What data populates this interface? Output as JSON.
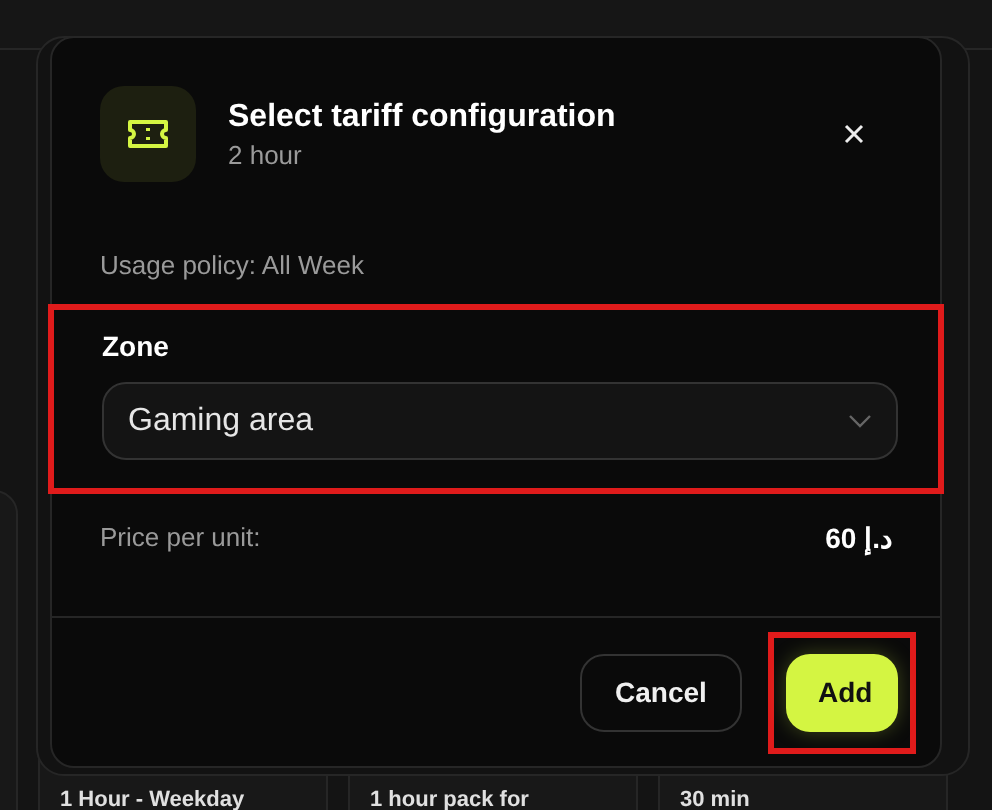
{
  "background_cards": [
    {
      "title": "1 Hour - Weekday"
    },
    {
      "title": "1 hour pack for"
    },
    {
      "title": "30 min"
    }
  ],
  "dialog": {
    "title": "Select tariff configuration",
    "subtitle": "2 hour",
    "usage_policy": "Usage policy: All Week",
    "zone": {
      "label": "Zone",
      "value": "Gaming area",
      "highlighted": true
    },
    "price": {
      "label": "Price per unit:",
      "value": "د.إ 60"
    },
    "buttons": [
      {
        "kind": "secondary",
        "label": "Cancel",
        "highlighted": false
      },
      {
        "kind": "primary",
        "label": "Add",
        "highlighted": true
      }
    ]
  }
}
